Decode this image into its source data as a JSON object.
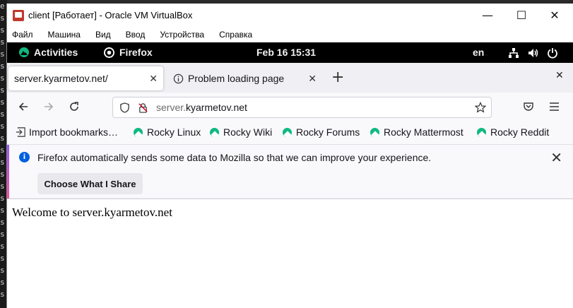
{
  "host": {
    "left_glyphs": [
      "e",
      "s",
      "s",
      "s",
      "s",
      "s",
      "s",
      "s",
      "s",
      "s",
      "s",
      "s",
      "s",
      "s",
      "s",
      "s",
      "s",
      "s",
      "s",
      "s",
      "s",
      "s",
      "s",
      "s",
      "s"
    ]
  },
  "vbox": {
    "title": "client [Работает] - Oracle VM VirtualBox",
    "menu": [
      "Файл",
      "Машина",
      "Вид",
      "Ввод",
      "Устройства",
      "Справка"
    ],
    "window_buttons": {
      "minimize": "—",
      "maximize": "☐",
      "close": "✕"
    }
  },
  "gnome": {
    "activities": "Activities",
    "app": "Firefox",
    "clock": "Feb 16  15:31",
    "lang": "en"
  },
  "firefox": {
    "tabs": [
      {
        "title": "server.kyarmetov.net/",
        "active": true
      },
      {
        "title": "Problem loading page",
        "active": false
      }
    ],
    "new_tab": "+",
    "url": {
      "host_dim": "server.",
      "host_main": "kyarmetov.net"
    },
    "bookmarks": [
      {
        "label": "Import bookmarks…",
        "icon": "import-icon"
      },
      {
        "label": "Rocky Linux",
        "icon": "rocky-icon"
      },
      {
        "label": "Rocky Wiki",
        "icon": "rocky-icon"
      },
      {
        "label": "Rocky Forums",
        "icon": "rocky-icon"
      },
      {
        "label": "Rocky Mattermost",
        "icon": "rocky-icon"
      },
      {
        "label": "Rocky Reddit",
        "icon": "rocky-icon"
      }
    ],
    "notification": {
      "text": "Firefox automatically sends some data to Mozilla so that we can improve your experience.",
      "button": "Choose What I Share"
    },
    "page": {
      "welcome": "Welcome to server.kyarmetov.net"
    }
  },
  "colors": {
    "gnome_bar": "#000000",
    "rocky_green": "#10b981",
    "info_blue": "#0060df"
  }
}
